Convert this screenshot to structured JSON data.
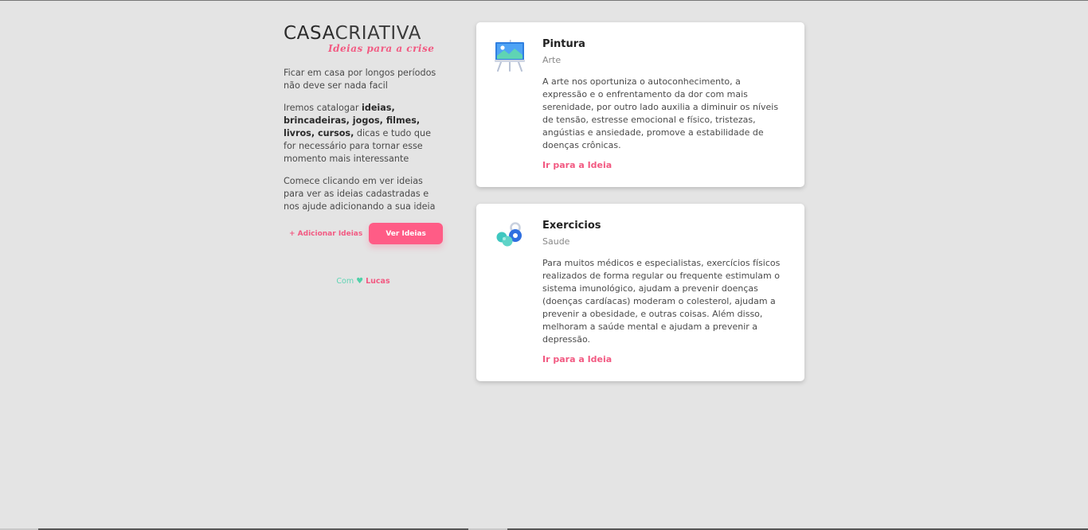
{
  "brand": {
    "name_left": "CASA",
    "name_right": "CRIATIVA",
    "tagline": "Ideias para a crise"
  },
  "sidebar": {
    "intro": "Ficar em casa por longos períodos não deve ser nada facil",
    "catalog_pre": "Iremos catalogar ",
    "catalog_bold": "ideias, brincadeiras, jogos, filmes, livros, cursos,",
    "catalog_post": " dicas e tudo que for necessário para tornar esse momento mais interessante",
    "cta_text": "Comece clicando em ver ideias para ver as ideias cadastradas e nos ajude adicionando a sua ideia",
    "add_label": "+ Adicionar Ideias",
    "view_label": "Ver Ideias",
    "credit_prefix": "Com",
    "credit_name": "Lucas"
  },
  "ideas": [
    {
      "title": "Pintura",
      "category": "Arte",
      "description": "A arte nos oportuniza o autoconhecimento, a expressão e o enfrentamento da dor com mais serenidade, por outro lado auxilia a diminuir os níveis de tensão, estresse emocional e físico, tristezas, angústias e ansiedade, promove a estabilidade de doenças crônicas.",
      "link_label": "Ir para a Ideia",
      "icon": "easel-painting-icon"
    },
    {
      "title": "Exercicios",
      "category": "Saude",
      "description": "Para muitos médicos e especialistas, exercícios físicos realizados de forma regular ou frequente estimulam o sistema imunológico, ajudam a prevenir doenças (doenças cardíacas) moderam o colesterol, ajudam a prevenir a obesidade, e outras coisas. Além disso, melhoram a saúde mental e ajudam a prevenir a depressão.",
      "link_label": "Ir para a Ideia",
      "icon": "dumbbell-icon"
    }
  ],
  "colors": {
    "accent": "#ff5c86",
    "credit_green": "#5fd4b4",
    "background": "#e4e4e4"
  }
}
